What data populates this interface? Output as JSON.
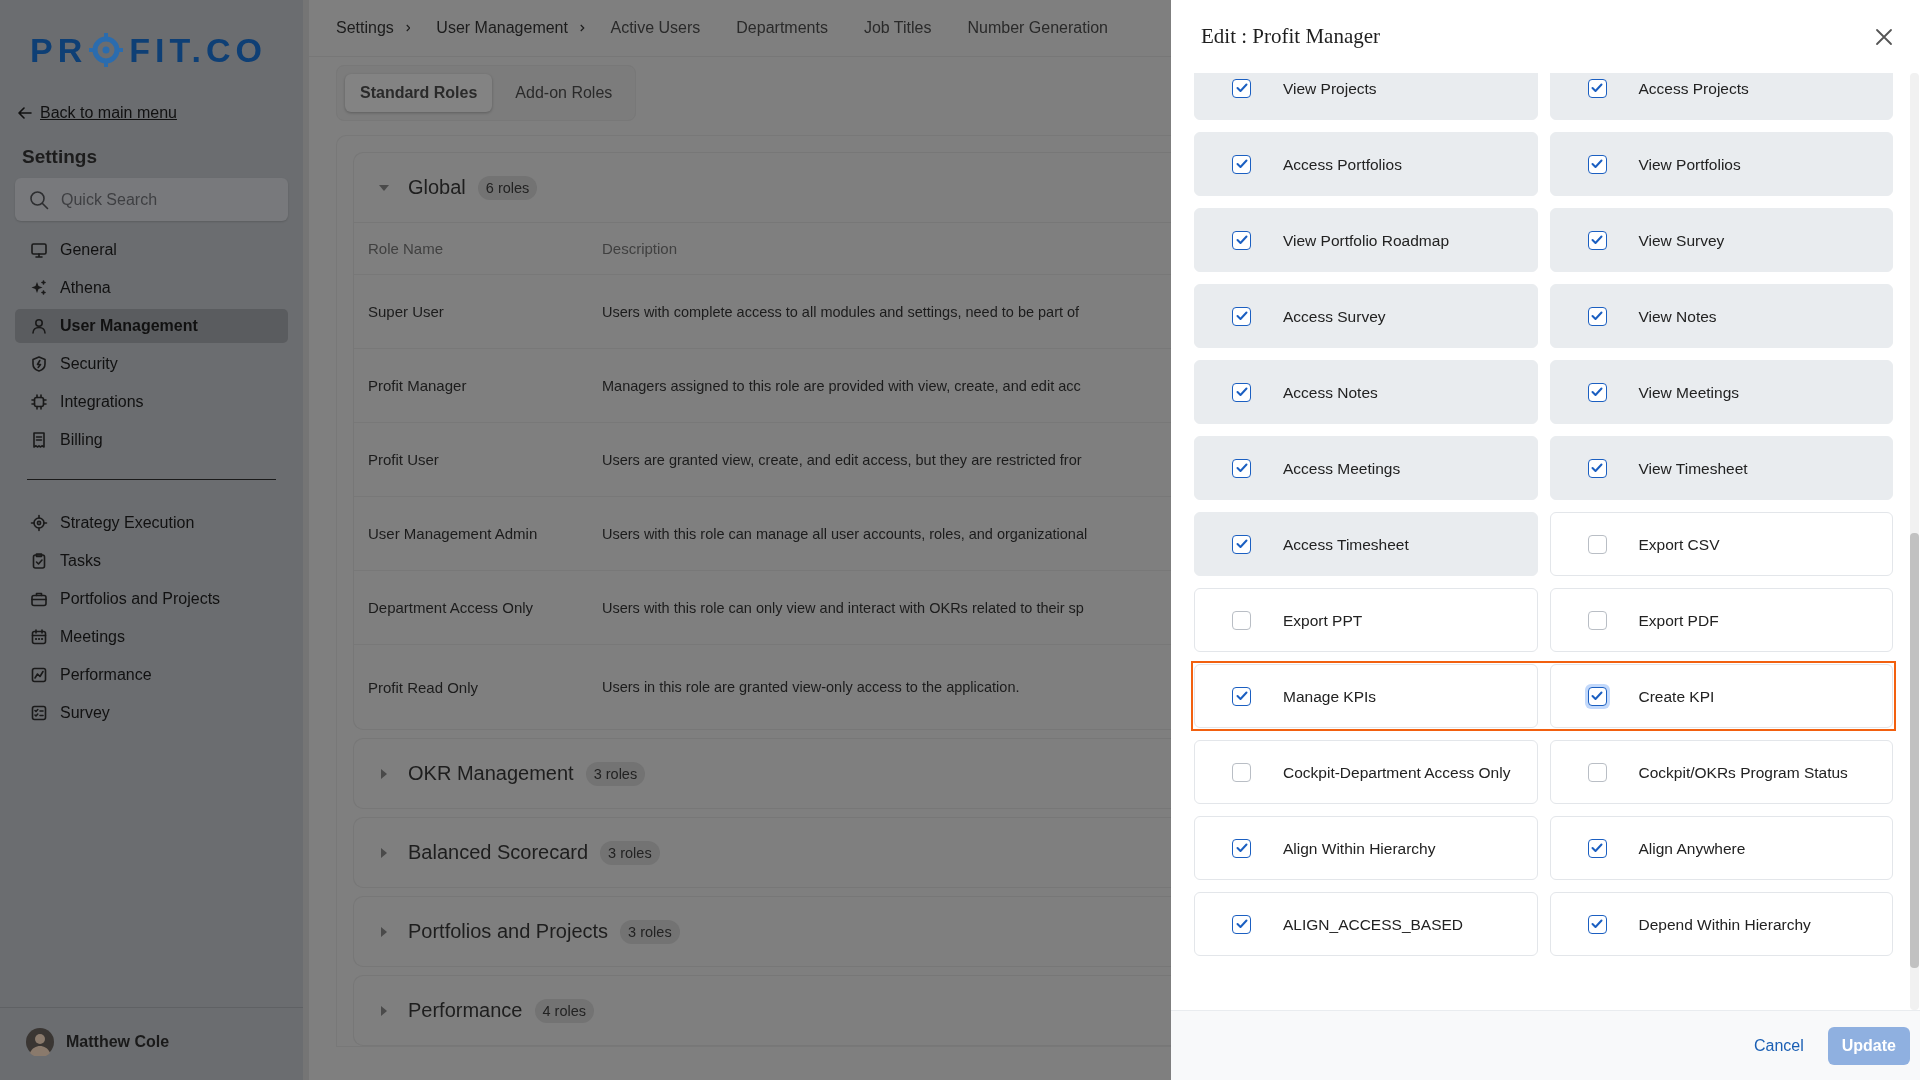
{
  "logo": {
    "before": "PR",
    "after": "FIT.CO"
  },
  "back_link": "Back to main menu",
  "sidebar": {
    "title": "Settings",
    "search": {
      "placeholder": "Quick Search"
    },
    "items": [
      {
        "label": "General",
        "selected": false
      },
      {
        "label": "Athena",
        "selected": false
      },
      {
        "label": "User Management",
        "selected": true
      },
      {
        "label": "Security",
        "selected": false
      },
      {
        "label": "Integrations",
        "selected": false
      },
      {
        "label": "Billing",
        "selected": false
      }
    ],
    "modules": [
      {
        "label": "Strategy Execution"
      },
      {
        "label": "Tasks"
      },
      {
        "label": "Portfolios and Projects"
      },
      {
        "label": "Meetings"
      },
      {
        "label": "Performance"
      },
      {
        "label": "Survey"
      }
    ]
  },
  "user": {
    "name": "Matthew Cole"
  },
  "breadcrumb": [
    "Settings",
    "User Management"
  ],
  "nav_tabs": [
    "Active Users",
    "Departments",
    "Job Titles",
    "Number Generation"
  ],
  "role_tabs": [
    {
      "label": "Standard Roles",
      "selected": true
    },
    {
      "label": "Add-on Roles",
      "selected": false
    }
  ],
  "groups": [
    {
      "name": "Global",
      "count": "6 roles",
      "expanded": true,
      "columns": [
        "Role Name",
        "Description"
      ],
      "rows": [
        {
          "name": "Super User",
          "description": "Users with complete access to all modules and settings, need to be part of"
        },
        {
          "name": "Profit Manager",
          "description": "Managers assigned to this role are provided with view, create, and edit acc"
        },
        {
          "name": "Profit User",
          "description": "Users are granted view, create, and edit access, but they are restricted fror"
        },
        {
          "name": "User Management Admin",
          "description": "Users with this role can manage all user accounts, roles, and organizational"
        },
        {
          "name": "Department Access Only",
          "description": "Users with this role can only view and interact with OKRs related to their sp"
        },
        {
          "name": "Profit Read Only",
          "description": "Users in this role are granted view-only access to the application."
        }
      ]
    },
    {
      "name": "OKR Management",
      "count": "3 roles",
      "expanded": false
    },
    {
      "name": "Balanced Scorecard",
      "count": "3 roles",
      "expanded": false
    },
    {
      "name": "Portfolios and Projects",
      "count": "3 roles",
      "expanded": false
    },
    {
      "name": "Performance",
      "count": "4 roles",
      "expanded": false
    }
  ],
  "drawer": {
    "title": "Edit : Profit Manager",
    "rows": [
      {
        "highlighted": false,
        "items": [
          {
            "label": "View Projects",
            "checked": true,
            "shaded": true,
            "focused": false
          },
          {
            "label": "Access Projects",
            "checked": true,
            "shaded": true,
            "focused": false
          }
        ]
      },
      {
        "highlighted": false,
        "items": [
          {
            "label": "Access Portfolios",
            "checked": true,
            "shaded": true,
            "focused": false
          },
          {
            "label": "View Portfolios",
            "checked": true,
            "shaded": true,
            "focused": false
          }
        ]
      },
      {
        "highlighted": false,
        "items": [
          {
            "label": "View Portfolio Roadmap",
            "checked": true,
            "shaded": true,
            "focused": false
          },
          {
            "label": "View Survey",
            "checked": true,
            "shaded": true,
            "focused": false
          }
        ]
      },
      {
        "highlighted": false,
        "items": [
          {
            "label": "Access Survey",
            "checked": true,
            "shaded": true,
            "focused": false
          },
          {
            "label": "View Notes",
            "checked": true,
            "shaded": true,
            "focused": false
          }
        ]
      },
      {
        "highlighted": false,
        "items": [
          {
            "label": "Access Notes",
            "checked": true,
            "shaded": true,
            "focused": false
          },
          {
            "label": "View Meetings",
            "checked": true,
            "shaded": true,
            "focused": false
          }
        ]
      },
      {
        "highlighted": false,
        "items": [
          {
            "label": "Access Meetings",
            "checked": true,
            "shaded": true,
            "focused": false
          },
          {
            "label": "View Timesheet",
            "checked": true,
            "shaded": true,
            "focused": false
          }
        ]
      },
      {
        "highlighted": false,
        "items": [
          {
            "label": "Access Timesheet",
            "checked": true,
            "shaded": true,
            "focused": false
          },
          {
            "label": "Export CSV",
            "checked": false,
            "shaded": false,
            "focused": false
          }
        ]
      },
      {
        "highlighted": false,
        "items": [
          {
            "label": "Export PPT",
            "checked": false,
            "shaded": false,
            "focused": false
          },
          {
            "label": "Export PDF",
            "checked": false,
            "shaded": false,
            "focused": false
          }
        ]
      },
      {
        "highlighted": true,
        "items": [
          {
            "label": "Manage KPIs",
            "checked": true,
            "shaded": false
          },
          {
            "label": "Create KPI",
            "checked": true,
            "shaded": false,
            "focused": true
          }
        ]
      },
      {
        "highlighted": false,
        "items": [
          {
            "label": "Cockpit-Department Access Only",
            "checked": false,
            "shaded": false,
            "focused": false
          },
          {
            "label": "Cockpit/OKRs Program Status",
            "checked": false,
            "shaded": false,
            "focused": false
          }
        ]
      },
      {
        "highlighted": false,
        "items": [
          {
            "label": "Align Within Hierarchy",
            "checked": true,
            "shaded": false,
            "focused": false
          },
          {
            "label": "Align Anywhere",
            "checked": true,
            "shaded": false,
            "focused": false
          }
        ]
      },
      {
        "highlighted": false,
        "items": [
          {
            "label": "ALIGN_ACCESS_BASED",
            "checked": true,
            "shaded": false,
            "focused": false
          },
          {
            "label": "Depend Within Hierarchy",
            "checked": true,
            "shaded": false,
            "focused": false
          }
        ]
      }
    ],
    "cancel": "Cancel",
    "update": {
      "label": "Update",
      "disabled": true
    }
  }
}
